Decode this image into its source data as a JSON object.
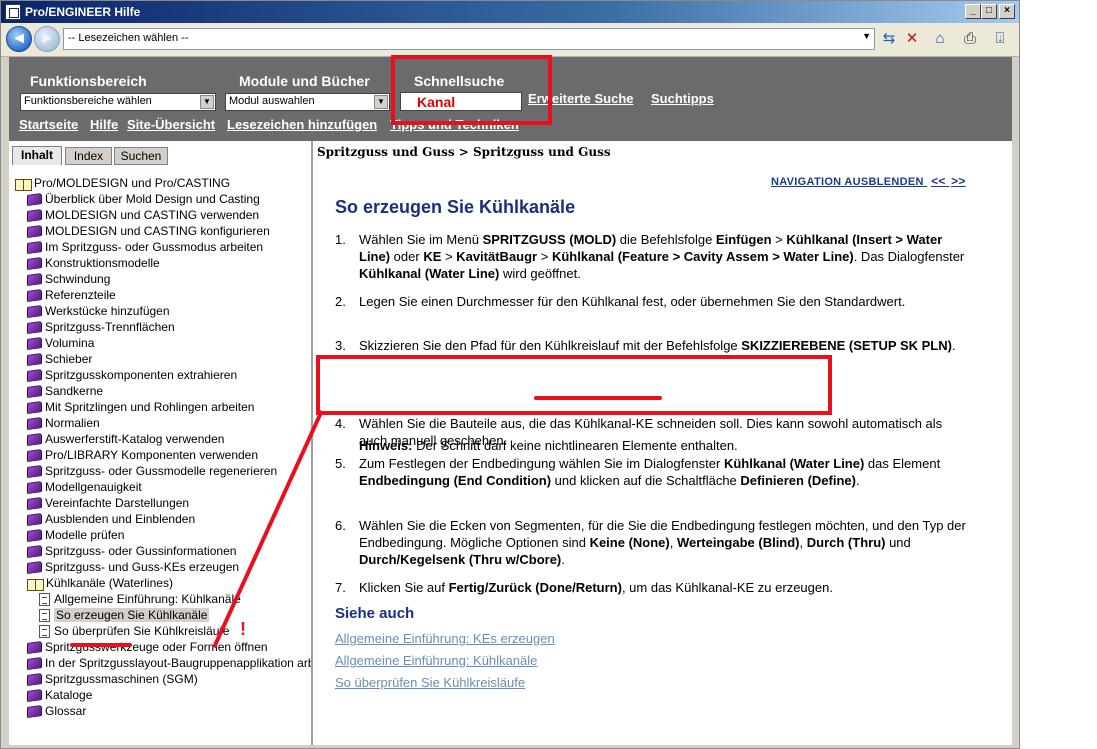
{
  "window": {
    "title": "Pro/ENGINEER Hilfe"
  },
  "toolbar": {
    "bookmark_placeholder": "-- Lesezeichen wählen --"
  },
  "header": {
    "functions_label": "Funktionsbereich",
    "functions_select": "Funktionsbereiche wählen",
    "modules_label": "Module und Bücher",
    "modules_select": "Modul auswahlen",
    "quicksearch_label": "Schnellsuche",
    "quicksearch_value": "Kanal",
    "advanced_search": "Erweiterte Suche",
    "search_tips": "Suchtipps",
    "links": [
      "Startseite",
      "Hilfe",
      "Site-Übersicht",
      "Lesezeichen hinzufügen",
      "Tipps und Techniken"
    ]
  },
  "tabs": [
    "Inhalt",
    "Index",
    "Suchen"
  ],
  "tree": [
    {
      "label": "Pro/MOLDESIGN und Pro/CASTING",
      "icon": "book-open",
      "level": 0
    },
    {
      "label": "Überblick über Mold Design und Casting",
      "icon": "book",
      "level": 1
    },
    {
      "label": "MOLDESIGN und CASTING verwenden",
      "icon": "book",
      "level": 1
    },
    {
      "label": "MOLDESIGN und CASTING konfigurieren",
      "icon": "book",
      "level": 1
    },
    {
      "label": "Im Spritzguss- oder Gussmodus arbeiten",
      "icon": "book",
      "level": 1
    },
    {
      "label": "Konstruktionsmodelle",
      "icon": "book",
      "level": 1
    },
    {
      "label": "Schwindung",
      "icon": "book",
      "level": 1
    },
    {
      "label": "Referenzteile",
      "icon": "book",
      "level": 1
    },
    {
      "label": "Werkstücke hinzufügen",
      "icon": "book",
      "level": 1
    },
    {
      "label": "Spritzguss-Trennflächen",
      "icon": "book",
      "level": 1
    },
    {
      "label": "Volumina",
      "icon": "book",
      "level": 1
    },
    {
      "label": "Schieber",
      "icon": "book",
      "level": 1
    },
    {
      "label": "Spritzgusskomponenten extrahieren",
      "icon": "book",
      "level": 1
    },
    {
      "label": "Sandkerne",
      "icon": "book",
      "level": 1
    },
    {
      "label": "Mit Spritzlingen und Rohlingen arbeiten",
      "icon": "book",
      "level": 1
    },
    {
      "label": "Normalien",
      "icon": "book",
      "level": 1
    },
    {
      "label": "Auswerferstift-Katalog verwenden",
      "icon": "book",
      "level": 1
    },
    {
      "label": "Pro/LIBRARY Komponenten verwenden",
      "icon": "book",
      "level": 1
    },
    {
      "label": "Spritzguss- oder Gussmodelle regenerieren",
      "icon": "book",
      "level": 1
    },
    {
      "label": "Modellgenauigkeit",
      "icon": "book",
      "level": 1
    },
    {
      "label": "Vereinfachte Darstellungen",
      "icon": "book",
      "level": 1
    },
    {
      "label": "Ausblenden und Einblenden",
      "icon": "book",
      "level": 1
    },
    {
      "label": "Modelle prüfen",
      "icon": "book",
      "level": 1
    },
    {
      "label": "Spritzguss- oder Gussinformationen",
      "icon": "book",
      "level": 1
    },
    {
      "label": "Spritzguss- und Guss-KEs erzeugen",
      "icon": "book",
      "level": 1
    },
    {
      "label": "Kühlkanäle (Waterlines)",
      "icon": "book-open",
      "level": 1
    },
    {
      "label": "Allgemeine Einführung: Kühlkanäle",
      "icon": "page",
      "level": 2
    },
    {
      "label": "So erzeugen Sie Kühlkanäle",
      "icon": "page",
      "level": 2,
      "selected": true
    },
    {
      "label": "So überprüfen Sie Kühlkreisläufe",
      "icon": "page",
      "level": 2
    },
    {
      "label": "Spritzgusswerkzeuge oder Formen öffnen",
      "icon": "book",
      "level": 1
    },
    {
      "label": "In der Spritzgusslayout-Baugruppenapplikation arbeiten",
      "icon": "book",
      "level": 1
    },
    {
      "label": "Spritzgussmaschinen (SGM)",
      "icon": "book",
      "level": 1
    },
    {
      "label": "Kataloge",
      "icon": "book",
      "level": 1
    },
    {
      "label": "Glossar",
      "icon": "book",
      "level": 1
    }
  ],
  "content": {
    "breadcrumb": "Spritzguss und Guss > Spritzguss und Guss",
    "nav_hide": "NAVIGATION AUSBLENDEN",
    "prev": "<<",
    "next": ">>",
    "title": "So erzeugen Sie Kühlkanäle",
    "steps": [
      "Wählen Sie im Menü <b>SPRITZGUSS (MOLD)</b> die Befehlsfolge <b>Einfügen</b> &gt; <b>Kühlkanal (Insert &gt; Water Line)</b> oder <b>KE</b> &gt; <b>KavitätBaugr</b> &gt; <b>Kühlkanal (Feature &gt; Cavity Assem &gt; Water Line)</b>. Das Dialogfenster <b>Kühlkanal (Water Line)</b> wird geöffnet.",
      "Legen Sie einen Durchmesser für den Kühlkanal fest, oder übernehmen Sie den Standardwert.",
      "Skizzieren Sie den Pfad für den Kühlkreislauf mit der Befehlsfolge <b>SKIZZIEREBENE (SETUP SK PLN)</b>.",
      "Wählen Sie die Bauteile aus, die das Kühlkanal-KE schneiden soll. Dies kann sowohl automatisch als auch manuell geschehen.",
      "Zum Festlegen der Endbedingung wählen Sie im Dialogfenster <b>Kühlkanal (Water Line)</b> das Element <b>Endbedingung (End Condition)</b> und klicken auf die Schaltfläche <b>Definieren (Define)</b>.",
      "Wählen Sie die Ecken von Segmenten, für die Sie die Endbedingung festlegen möchten, und den Typ der Endbedingung. Mögliche Optionen sind <b>Keine (None)</b>, <b>Werteingabe (Blind)</b>, <b>Durch (Thru)</b> und <b>Durch/Kegelsenk (Thru w/Cbore)</b>.",
      "Klicken Sie auf <b>Fertig/Zurück (Done/Return)</b>, um das Kühlkanal-KE zu erzeugen."
    ],
    "note_label": "Hinweis:",
    "note_text": "Der Schnitt darf keine nichtlinearen Elemente enthalten.",
    "see_also_title": "Siehe auch",
    "see_also_links": [
      "Allgemeine Einführung: KEs erzeugen",
      "Allgemeine Einführung: Kühlkanäle",
      "So überprüfen Sie Kühlkreisläufe"
    ]
  },
  "annotation": {
    "mark": "!",
    "color": "#e8101c"
  }
}
